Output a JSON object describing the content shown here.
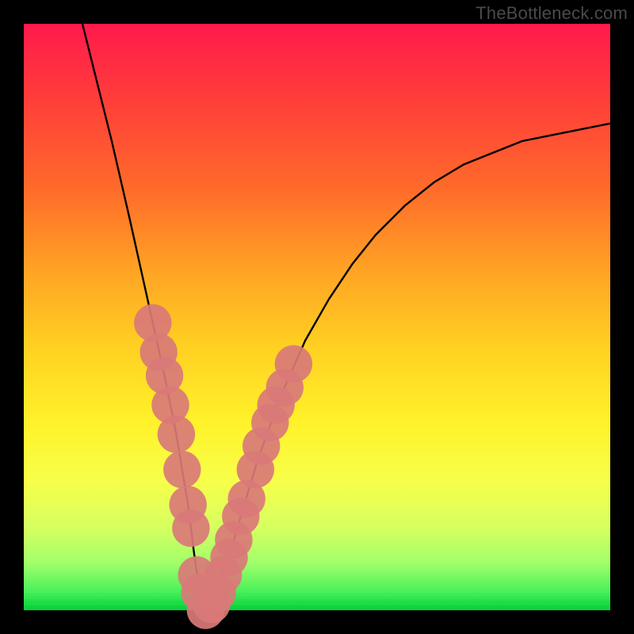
{
  "watermark": "TheBottleneck.com",
  "chart_data": {
    "type": "line",
    "title": "",
    "xlabel": "",
    "ylabel": "",
    "xlim": [
      0,
      100
    ],
    "ylim": [
      0,
      100
    ],
    "grid": false,
    "series": [
      {
        "name": "bottleneck-curve",
        "color": "#000000",
        "x": [
          10,
          12,
          15,
          18,
          20,
          22,
          24,
          26,
          28,
          29,
          30,
          31,
          32,
          33,
          35,
          37,
          40,
          44,
          48,
          52,
          56,
          60,
          65,
          70,
          75,
          80,
          85,
          90,
          95,
          100
        ],
        "y": [
          100,
          92,
          80,
          67,
          58,
          49,
          40,
          30,
          18,
          10,
          3,
          0,
          1,
          3,
          9,
          16,
          26,
          37,
          46,
          53,
          59,
          64,
          69,
          73,
          76,
          78,
          80,
          81,
          82,
          83
        ]
      }
    ],
    "markers": {
      "name": "highlighted-points",
      "color": "#d97a78",
      "radius": 3.2,
      "points_xy": [
        [
          22,
          49
        ],
        [
          23,
          44
        ],
        [
          24,
          40
        ],
        [
          25,
          35
        ],
        [
          26,
          30
        ],
        [
          27,
          24
        ],
        [
          28,
          18
        ],
        [
          28.5,
          14
        ],
        [
          29.5,
          6
        ],
        [
          30,
          3
        ],
        [
          31,
          0
        ],
        [
          32,
          1
        ],
        [
          33,
          3
        ],
        [
          34,
          6
        ],
        [
          35,
          9
        ],
        [
          35.8,
          12
        ],
        [
          37,
          16
        ],
        [
          38,
          19
        ],
        [
          39.5,
          24
        ],
        [
          40.5,
          28
        ],
        [
          42,
          32
        ],
        [
          43,
          35
        ],
        [
          44.5,
          38
        ],
        [
          46,
          42
        ]
      ]
    }
  }
}
